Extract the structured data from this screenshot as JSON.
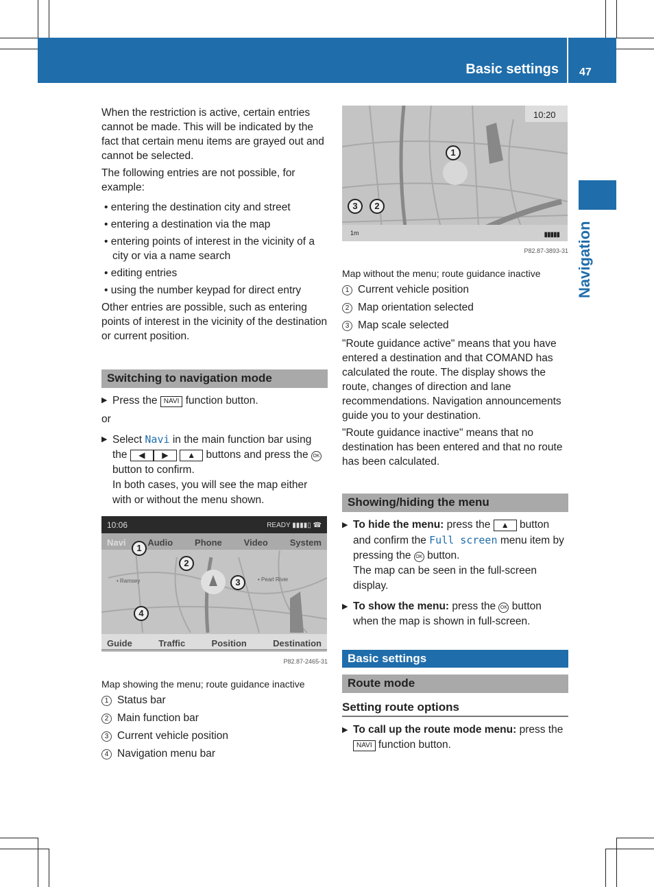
{
  "header": {
    "title": "Basic settings",
    "page": "47"
  },
  "side_tab": "Navigation",
  "left": {
    "intro1": "When the restriction is active, certain entries cannot be made. This will be indicated by the fact that certain menu items are grayed out and cannot be selected.",
    "intro2": "The following entries are not possible, for example:",
    "bullets": [
      "entering the destination city and street",
      "entering a destination via the map",
      "entering points of interest in the vicinity of a city or via a name search",
      "editing entries",
      "using the number keypad for direct entry"
    ],
    "other": "Other entries are possible, such as entering points of interest in the vicinity of the destination or current position.",
    "section": "Switching to navigation mode",
    "step1_pre": "Press the",
    "key_navi": "NAVI",
    "step1_post": "function button.",
    "or": "or",
    "step2_pre": "Select",
    "step2_navi": "Navi",
    "step2_mid": "in the main function bar using the",
    "btn_left": "◀",
    "btn_right": "▶",
    "btn_up": "▲",
    "step2_post": "buttons and press the",
    "ok": "OK",
    "step2_end": "button to confirm.",
    "step2_note": "In both cases, you will see the map either with or without the menu shown.",
    "map": {
      "time": "10:06",
      "status": "READY ▮▮▮▮▯ ☎",
      "menu": [
        "Navi",
        "Audio",
        "Phone",
        "Video",
        "System"
      ],
      "bottom": [
        "Guide",
        "Traffic",
        "Position",
        "Destination"
      ],
      "places": [
        "Ramsey",
        "Pearl River"
      ],
      "code": "P82.87-2465-31"
    },
    "caption": "Map showing the menu; route guidance inactive",
    "legend": [
      {
        "n": "1",
        "t": "Status bar"
      },
      {
        "n": "2",
        "t": "Main function bar"
      },
      {
        "n": "3",
        "t": "Current vehicle position"
      },
      {
        "n": "4",
        "t": "Navigation menu bar"
      }
    ]
  },
  "right": {
    "map": {
      "time": "10:20",
      "scale": "1m",
      "code": "P82.87-3893-31"
    },
    "caption": "Map without the menu; route guidance inactive",
    "legend": [
      {
        "n": "1",
        "t": "Current vehicle position"
      },
      {
        "n": "2",
        "t": "Map orientation selected"
      },
      {
        "n": "3",
        "t": "Map scale selected"
      }
    ],
    "para1": "\"Route guidance active\" means that you have entered a destination and that COMAND has calculated the route. The display shows the route, changes of direction and lane recommendations. Navigation announcements guide you to your destination.",
    "para2": "\"Route guidance inactive\" means that no destination has been entered and that no route has been calculated.",
    "section": "Showing/hiding the menu",
    "hide_bold": "To hide the menu:",
    "hide_1": "press the",
    "btn_up": "▲",
    "hide_2": "button and confirm the",
    "full_screen": "Full screen",
    "hide_3": "menu item by pressing the",
    "ok": "OK",
    "hide_4": "button.",
    "hide_note": "The map can be seen in the full-screen display.",
    "show_bold": "To show the menu:",
    "show_1": "press the",
    "show_2": "button when the map is shown in full-screen.",
    "basic": "Basic settings",
    "route_mode": "Route mode",
    "sub": "Setting route options",
    "call_bold": "To call up the route mode menu:",
    "call_1": "press the",
    "key_navi": "NAVI",
    "call_2": "function button."
  }
}
